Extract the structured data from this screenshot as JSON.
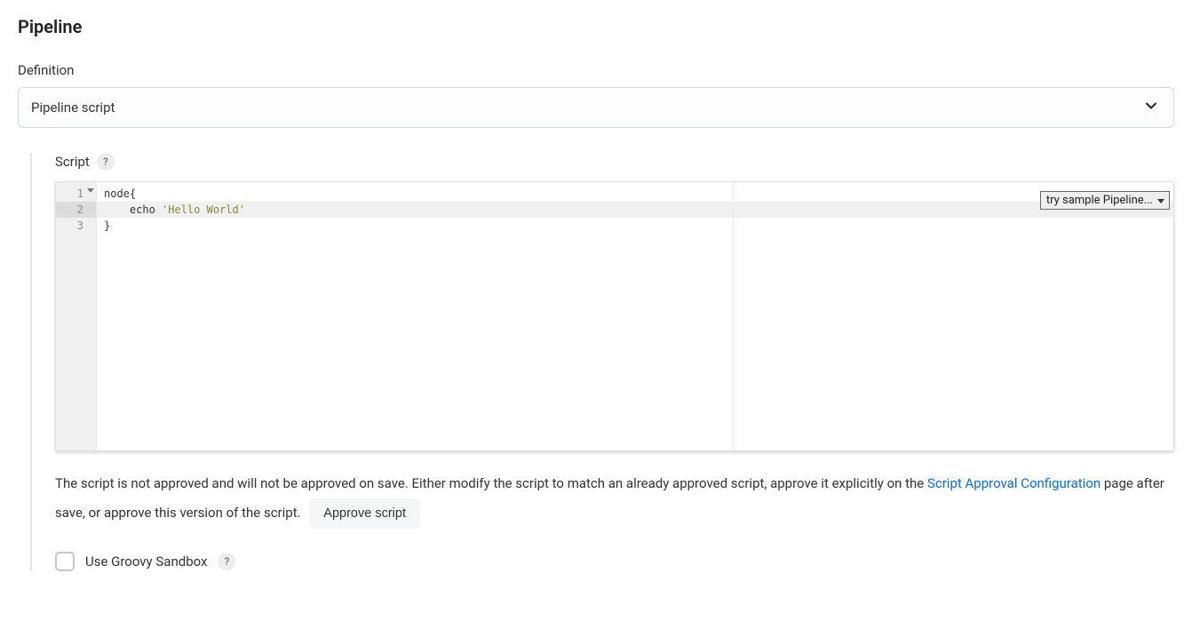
{
  "section": {
    "title": "Pipeline"
  },
  "definition": {
    "label": "Definition",
    "selected": "Pipeline script"
  },
  "script": {
    "label": "Script",
    "help_symbol": "?",
    "sample_dropdown": "try sample Pipeline...",
    "lines": [
      {
        "n": "1",
        "text_plain": "node{",
        "active": false,
        "foldable": true
      },
      {
        "n": "2",
        "text_prefix": "    echo ",
        "text_string": "'Hello World'",
        "active": true,
        "foldable": false
      },
      {
        "n": "3",
        "text_plain": "}",
        "active": false,
        "foldable": false
      }
    ]
  },
  "warning": {
    "text_before_link": "The script is not approved and will not be approved on save. Either modify the script to match an already approved script, approve it explicitly on the ",
    "link_text": "Script Approval Configuration",
    "text_after_link": " page after save, or approve this version of the script.",
    "approve_button": "Approve script"
  },
  "sandbox": {
    "label": "Use Groovy Sandbox",
    "help_symbol": "?"
  }
}
